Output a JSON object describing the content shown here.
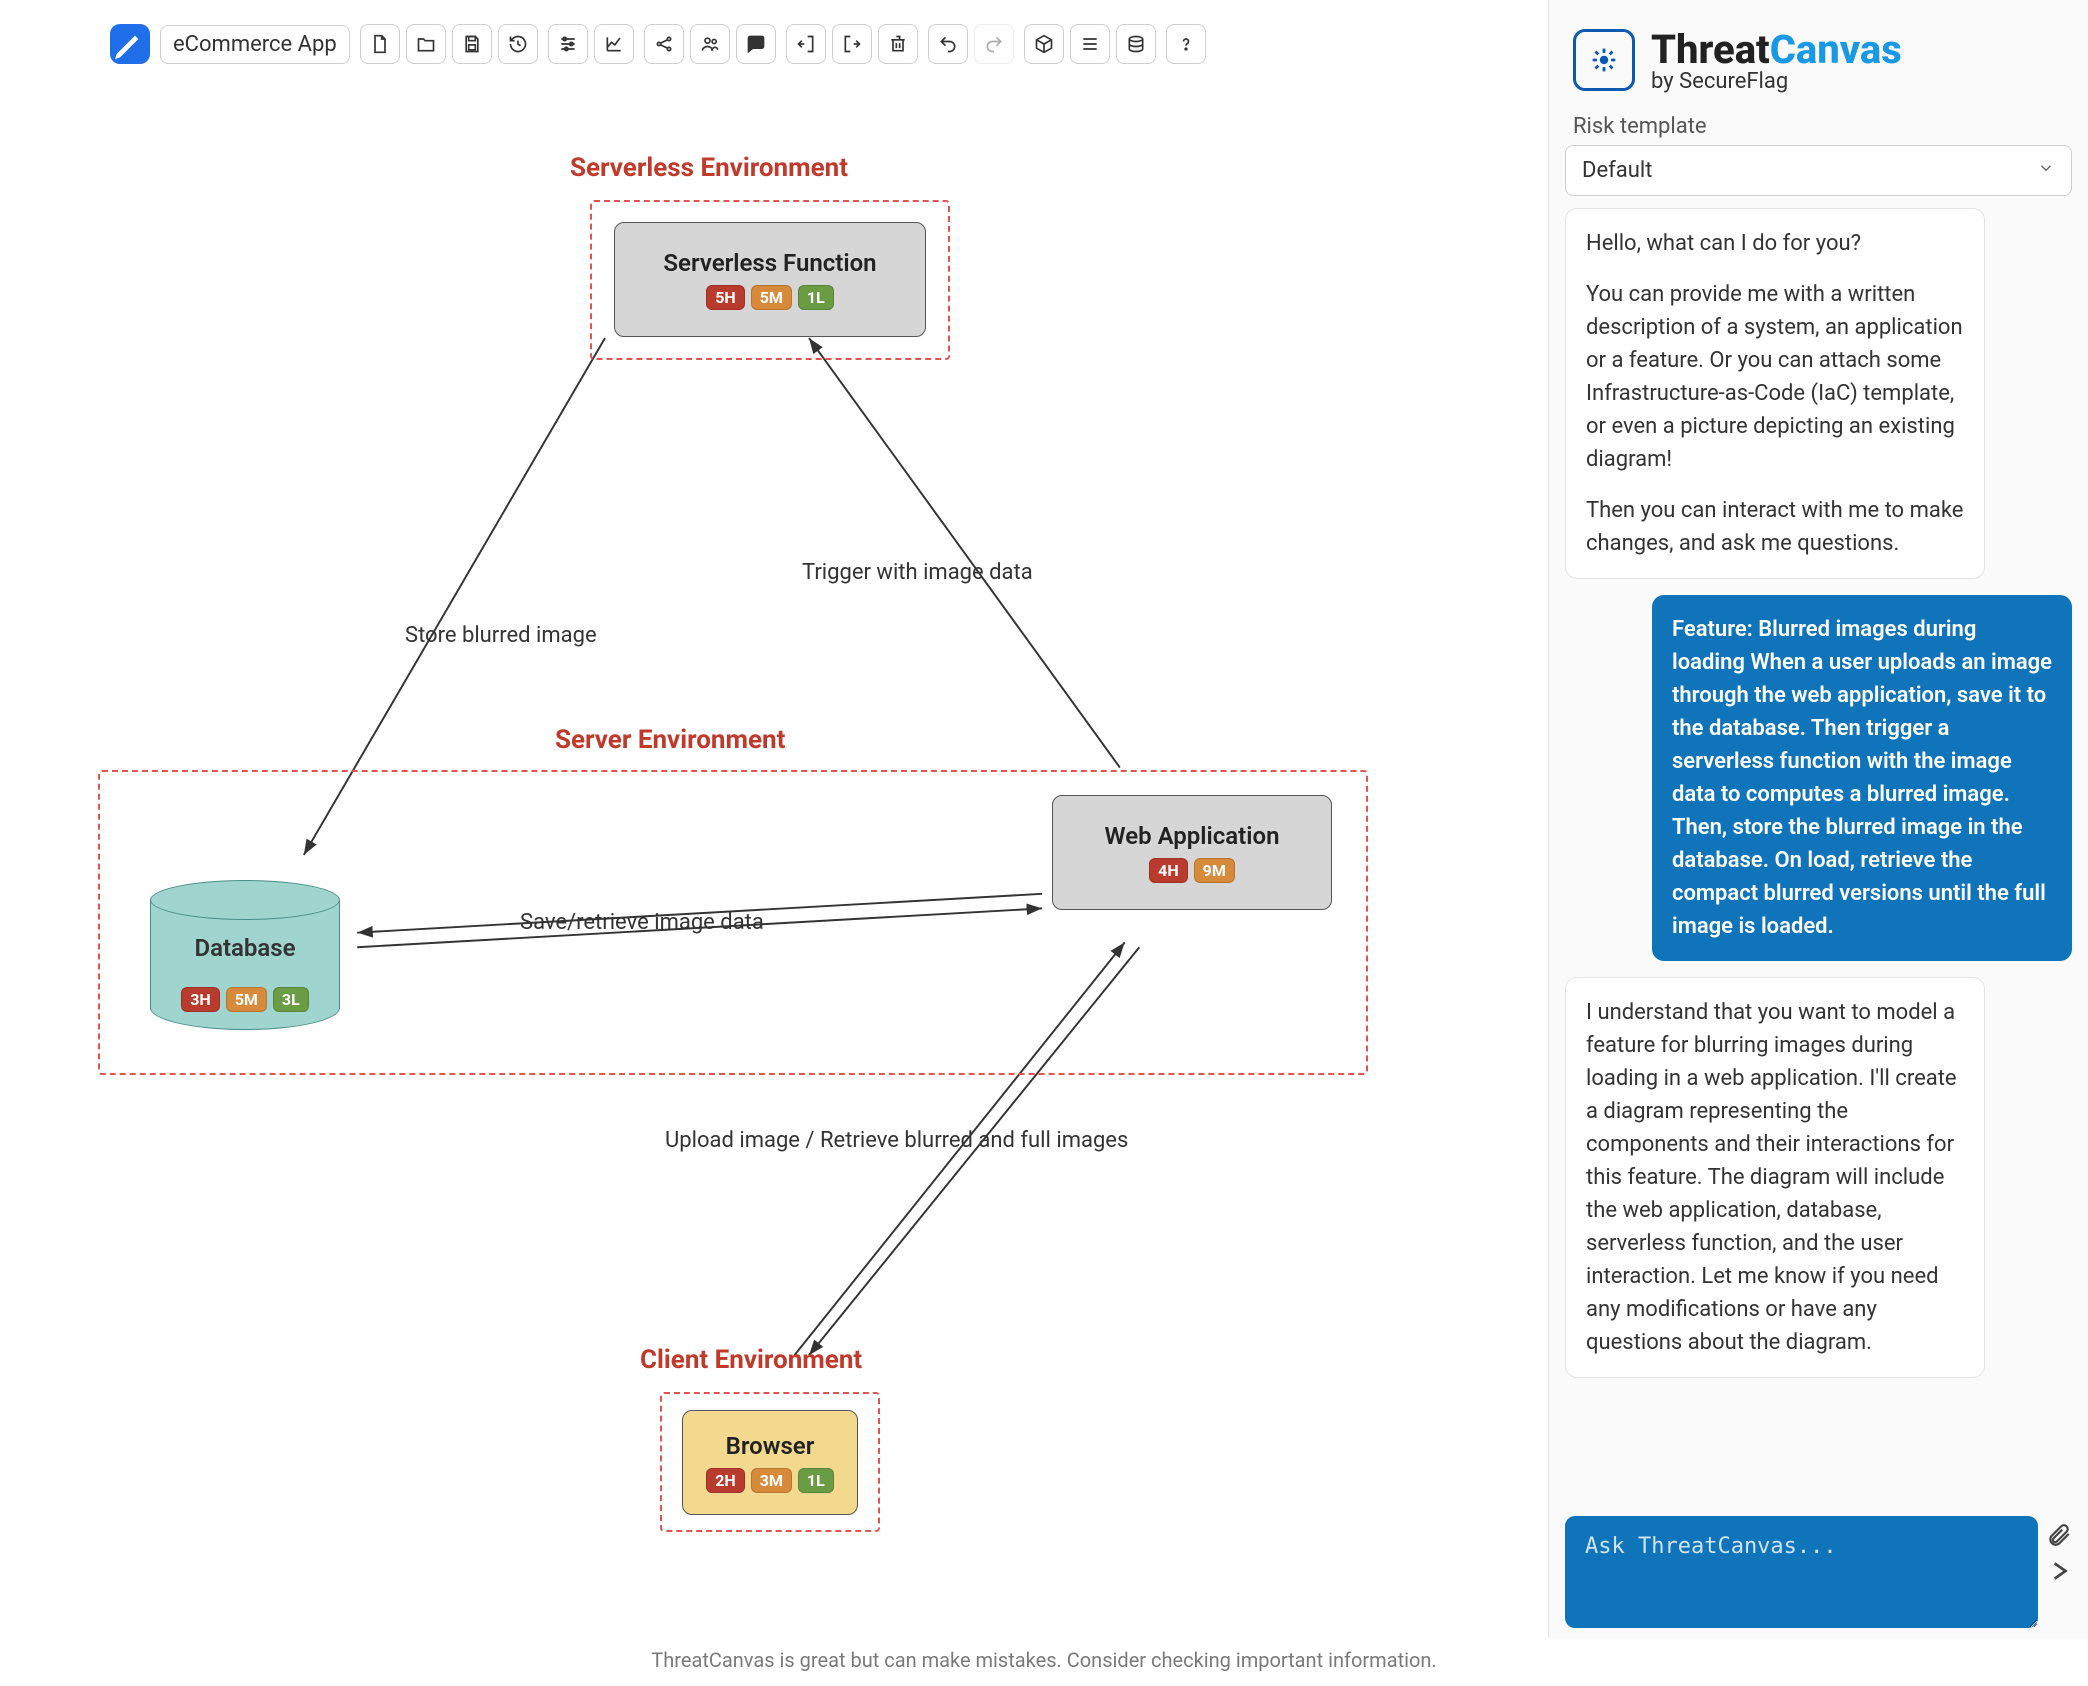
{
  "app_title": "eCommerce App",
  "toolbar_icons": [
    "file-icon",
    "folder-icon",
    "save-icon",
    "undo-icon",
    "sliders-icon",
    "chart-icon",
    "share-icon",
    "users-icon",
    "comment-icon",
    "login-icon",
    "logout-icon",
    "trash-icon",
    "undo2-icon",
    "redo-icon",
    "cube-icon",
    "list-icon",
    "stack-icon",
    "help-icon"
  ],
  "boundaries": {
    "serverless": {
      "label": "Serverless Environment"
    },
    "server": {
      "label": "Server Environment"
    },
    "client": {
      "label": "Client Environment"
    }
  },
  "nodes": {
    "serverless_function": {
      "title": "Serverless Function",
      "badges": [
        {
          "t": "5H",
          "cls": "h"
        },
        {
          "t": "5M",
          "cls": "m"
        },
        {
          "t": "1L",
          "cls": "l"
        }
      ]
    },
    "web_application": {
      "title": "Web Application",
      "badges": [
        {
          "t": "4H",
          "cls": "h"
        },
        {
          "t": "9M",
          "cls": "m"
        }
      ]
    },
    "database": {
      "title": "Database",
      "badges": [
        {
          "t": "3H",
          "cls": "h"
        },
        {
          "t": "5M",
          "cls": "m"
        },
        {
          "t": "3L",
          "cls": "l"
        }
      ]
    },
    "browser": {
      "title": "Browser",
      "badges": [
        {
          "t": "2H",
          "cls": "h"
        },
        {
          "t": "3M",
          "cls": "m"
        },
        {
          "t": "1L",
          "cls": "l"
        }
      ]
    }
  },
  "edges": {
    "store_blurred": "Store blurred image",
    "trigger_image": "Trigger with image data",
    "save_retrieve": "Save/retrieve image data",
    "upload_retrieve": "Upload image / Retrieve blurred and full images"
  },
  "brand": {
    "name_a": "Threat",
    "name_b": "Canvas",
    "byline": "by SecureFlag"
  },
  "risk": {
    "label": "Risk template",
    "selected": "Default"
  },
  "chat": {
    "greeting_1": "Hello, what can I do for you?",
    "greeting_2": "You can provide me with a written description of a system, an application or a feature. Or you can attach some Infrastructure-as-Code (IaC) template, or even a picture depicting an existing diagram!",
    "greeting_3": "Then you can interact with me to make changes, and ask me questions.",
    "user_msg": "Feature: Blurred images during loading When a user uploads an image through the web application, save it to the database. Then trigger a serverless function with the image data to computes a blurred image. Then, store the blurred image in the database. On load, retrieve the compact blurred versions until the full image is loaded.",
    "bot_reply": "I understand that you want to model a feature for blurring images during loading in a web application. I'll create a diagram representing the components and their interactions for this feature. The diagram will include the web application, database, serverless function, and the user interaction. Let me know if you need any modifications or have any questions about the diagram.",
    "input_placeholder": "Ask ThreatCanvas..."
  },
  "footer": "ThreatCanvas is great but can make mistakes. Consider checking important information."
}
